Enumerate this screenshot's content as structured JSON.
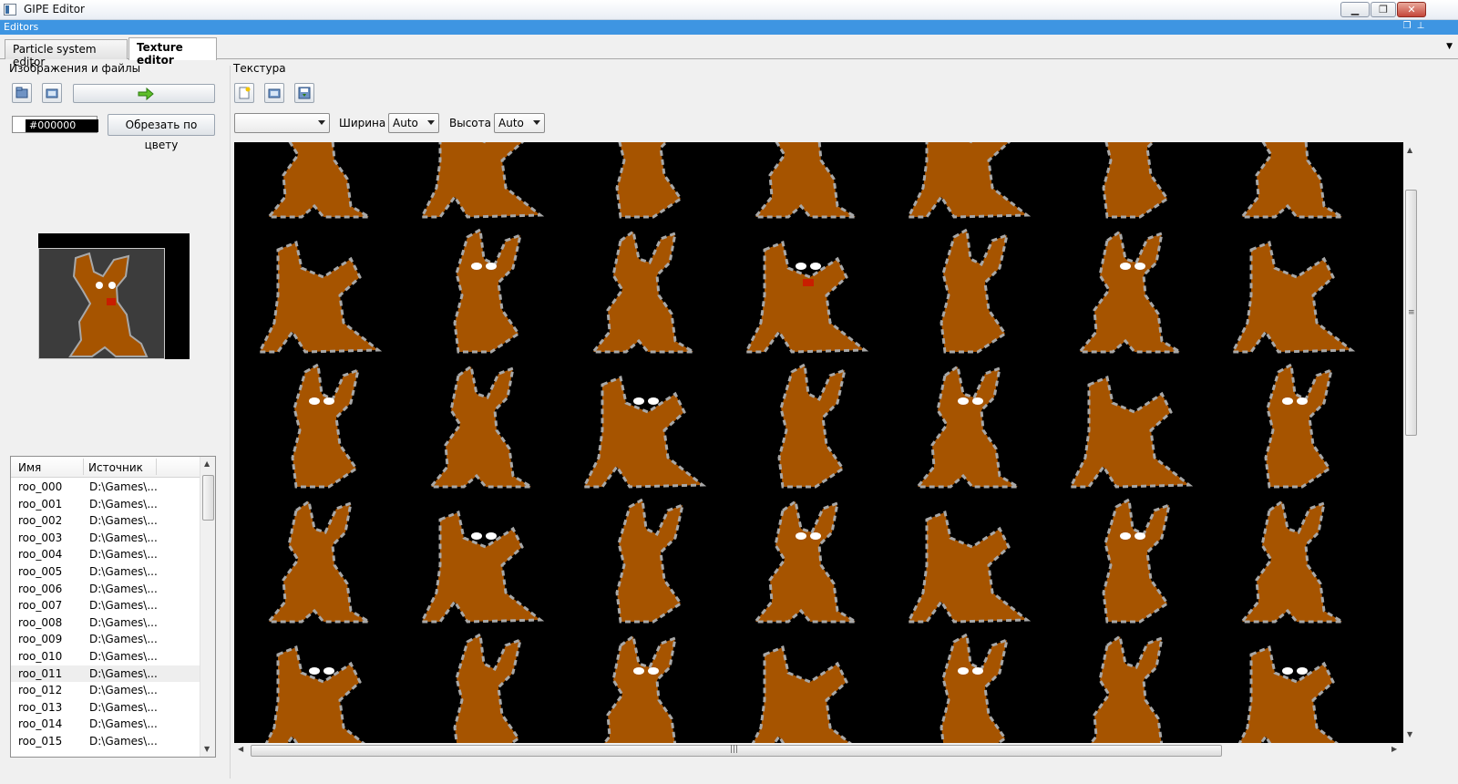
{
  "window": {
    "title": "GIPE Editor"
  },
  "dock": {
    "label": "Editors"
  },
  "tabs": [
    {
      "label": "Particle system editor",
      "active": false
    },
    {
      "label": "Texture editor",
      "active": true
    }
  ],
  "images_panel": {
    "title": "Изображения и файлы",
    "color_value": "#000000",
    "crop_button": "Обрезать по цвету",
    "columns": [
      "Имя",
      "Источник"
    ],
    "files": [
      {
        "name": "roo_000",
        "source": "D:\\Games\\..."
      },
      {
        "name": "roo_001",
        "source": "D:\\Games\\..."
      },
      {
        "name": "roo_002",
        "source": "D:\\Games\\..."
      },
      {
        "name": "roo_003",
        "source": "D:\\Games\\..."
      },
      {
        "name": "roo_004",
        "source": "D:\\Games\\..."
      },
      {
        "name": "roo_005",
        "source": "D:\\Games\\..."
      },
      {
        "name": "roo_006",
        "source": "D:\\Games\\..."
      },
      {
        "name": "roo_007",
        "source": "D:\\Games\\..."
      },
      {
        "name": "roo_008",
        "source": "D:\\Games\\..."
      },
      {
        "name": "roo_009",
        "source": "D:\\Games\\..."
      },
      {
        "name": "roo_010",
        "source": "D:\\Games\\..."
      },
      {
        "name": "roo_011",
        "source": "D:\\Games\\..."
      },
      {
        "name": "roo_012",
        "source": "D:\\Games\\..."
      },
      {
        "name": "roo_013",
        "source": "D:\\Games\\..."
      },
      {
        "name": "roo_014",
        "source": "D:\\Games\\..."
      },
      {
        "name": "roo_015",
        "source": "D:\\Games\\..."
      }
    ],
    "selected_file": "roo_011"
  },
  "texture_panel": {
    "title": "Текстура",
    "format_value": "",
    "width_label": "Ширина",
    "width_value": "Auto",
    "height_label": "Высота",
    "height_value": "Auto"
  },
  "colors": {
    "accent": "#3e95e2",
    "sprite_body": "#a65400",
    "sprite_highlight": "#a8a8a8",
    "sprite_accent": "#c81e00",
    "canvas_bg": "#000000"
  }
}
